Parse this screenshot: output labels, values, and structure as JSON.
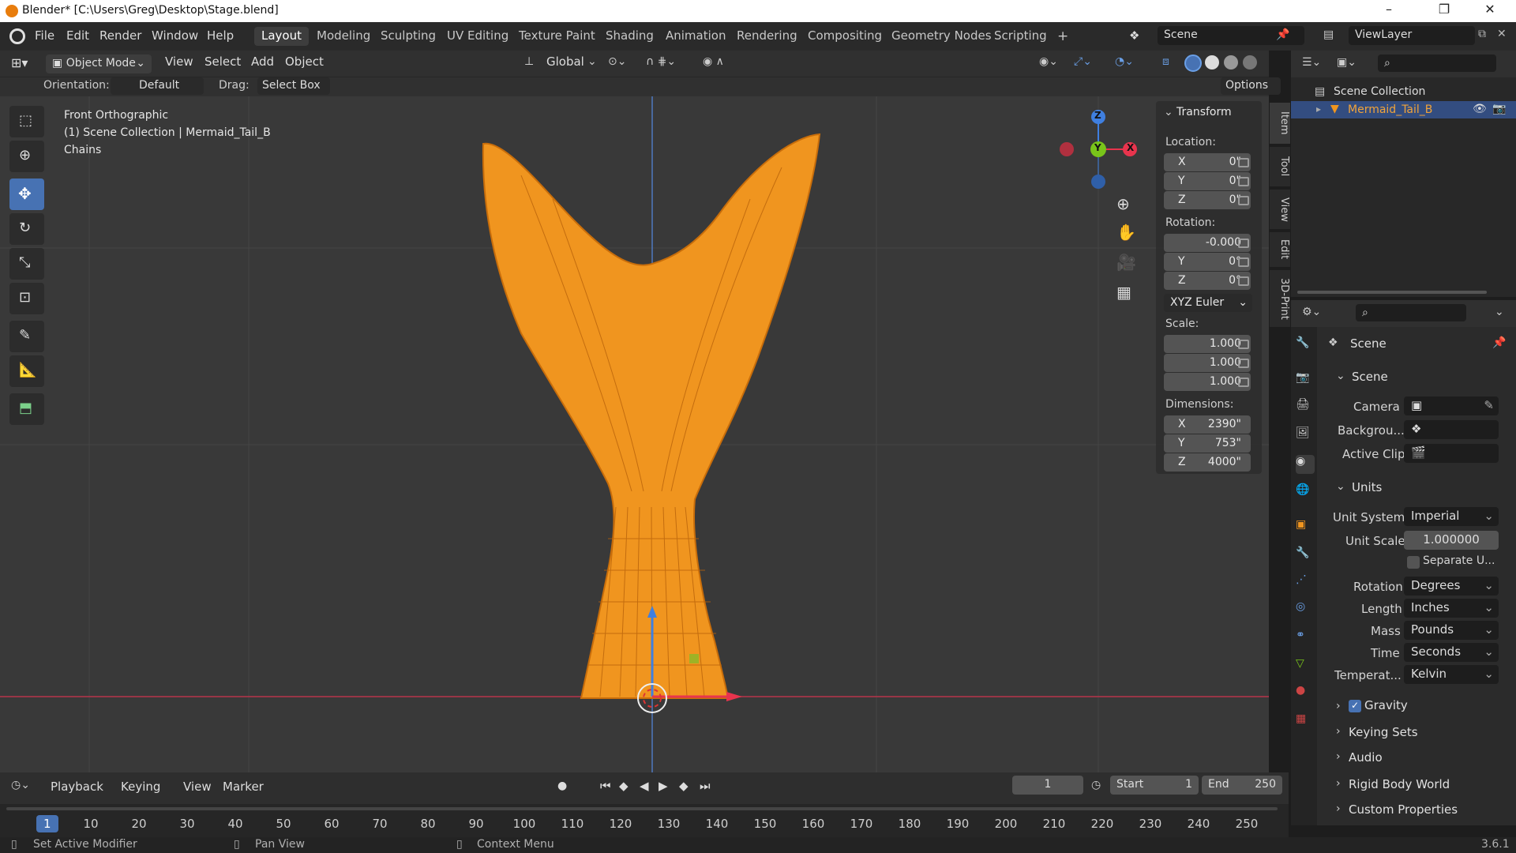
{
  "window": {
    "title": "Blender* [C:\\Users\\Greg\\Desktop\\Stage.blend]",
    "min": "–",
    "max": "❐",
    "close": "✕"
  },
  "menubar": {
    "menus": [
      "File",
      "Edit",
      "Render",
      "Window",
      "Help"
    ],
    "workspaces": [
      "Layout",
      "Modeling",
      "Sculpting",
      "UV Editing",
      "Texture Paint",
      "Shading",
      "Animation",
      "Rendering",
      "Compositing",
      "Geometry Nodes",
      "Scripting"
    ],
    "add_tab": "+",
    "scene": "Scene",
    "view_layer": "ViewLayer"
  },
  "viewport_header": {
    "mode": "Object Mode",
    "menus": [
      "View",
      "Select",
      "Add",
      "Object"
    ],
    "transform_orientation": "Global",
    "options": "Options",
    "orientation_label": "Orientation:",
    "orientation": "Default",
    "drag_label": "Drag:",
    "drag": "Select Box"
  },
  "viewport_overlay": {
    "view_name": "Front Orthographic",
    "collection_info": "(1) Scene Collection | Mermaid_Tail_B",
    "modifier": "Chains"
  },
  "gizmo": {
    "z": "Z",
    "y": "Y",
    "x": "X"
  },
  "npanel": {
    "header": "Transform",
    "location_label": "Location:",
    "location": [
      {
        "axis": "X",
        "value": "0\""
      },
      {
        "axis": "Y",
        "value": "0\""
      },
      {
        "axis": "Z",
        "value": "0\""
      }
    ],
    "rotation_label": "Rotation:",
    "rotation": [
      {
        "axis": "",
        "value": "-0.000"
      },
      {
        "axis": "Y",
        "value": "0°"
      },
      {
        "axis": "Z",
        "value": "0°"
      }
    ],
    "rotation_mode": "XYZ Euler",
    "scale_label": "Scale:",
    "scale": [
      {
        "axis": "",
        "value": "1.000"
      },
      {
        "axis": "",
        "value": "1.000"
      },
      {
        "axis": "",
        "value": "1.000"
      }
    ],
    "dimensions_label": "Dimensions:",
    "dimensions": [
      {
        "axis": "X",
        "value": "2390\""
      },
      {
        "axis": "Y",
        "value": "753\""
      },
      {
        "axis": "Z",
        "value": "4000\""
      }
    ],
    "tabs": [
      "Item",
      "Tool",
      "View",
      "Edit",
      "3D-Print"
    ]
  },
  "outliner": {
    "collection": "Scene Collection",
    "object": "Mermaid_Tail_B"
  },
  "properties": {
    "context": "Scene",
    "scene_section": "Scene",
    "camera_label": "Camera",
    "background_label": "Backgrou...",
    "active_clip_label": "Active Clip",
    "units_section": "Units",
    "unit_system_label": "Unit System",
    "unit_system": "Imperial",
    "unit_scale_label": "Unit Scale",
    "unit_scale": "1.000000",
    "separate_units": "Separate U...",
    "rotation_label": "Rotation",
    "rotation": "Degrees",
    "length_label": "Length",
    "length": "Inches",
    "mass_label": "Mass",
    "mass": "Pounds",
    "time_label": "Time",
    "time": "Seconds",
    "temperature_label": "Temperat...",
    "temperature": "Kelvin",
    "gravity": "Gravity",
    "keying_sets": "Keying Sets",
    "audio": "Audio",
    "rigid_body_world": "Rigid Body World",
    "custom_properties": "Custom Properties"
  },
  "timeline": {
    "menus": [
      "Playback",
      "Keying",
      "View",
      "Marker"
    ],
    "current_frame": "1",
    "start_label": "Start",
    "start": "1",
    "end_label": "End",
    "end": "250",
    "ticks": [
      "1",
      "10",
      "20",
      "30",
      "40",
      "50",
      "60",
      "70",
      "80",
      "90",
      "100",
      "110",
      "120",
      "130",
      "140",
      "150",
      "160",
      "170",
      "180",
      "190",
      "200",
      "210",
      "220",
      "230",
      "240",
      "250"
    ]
  },
  "statusbar": {
    "left": "Set Active Modifier",
    "middle": "Pan View",
    "right": "Context Menu",
    "version": "3.6.1"
  },
  "colors": {
    "accent": "#4772b3",
    "object": "#f0951f",
    "x_axis": "#e8344d",
    "y_axis": "#79c51a",
    "z_axis": "#3f7fe0"
  }
}
